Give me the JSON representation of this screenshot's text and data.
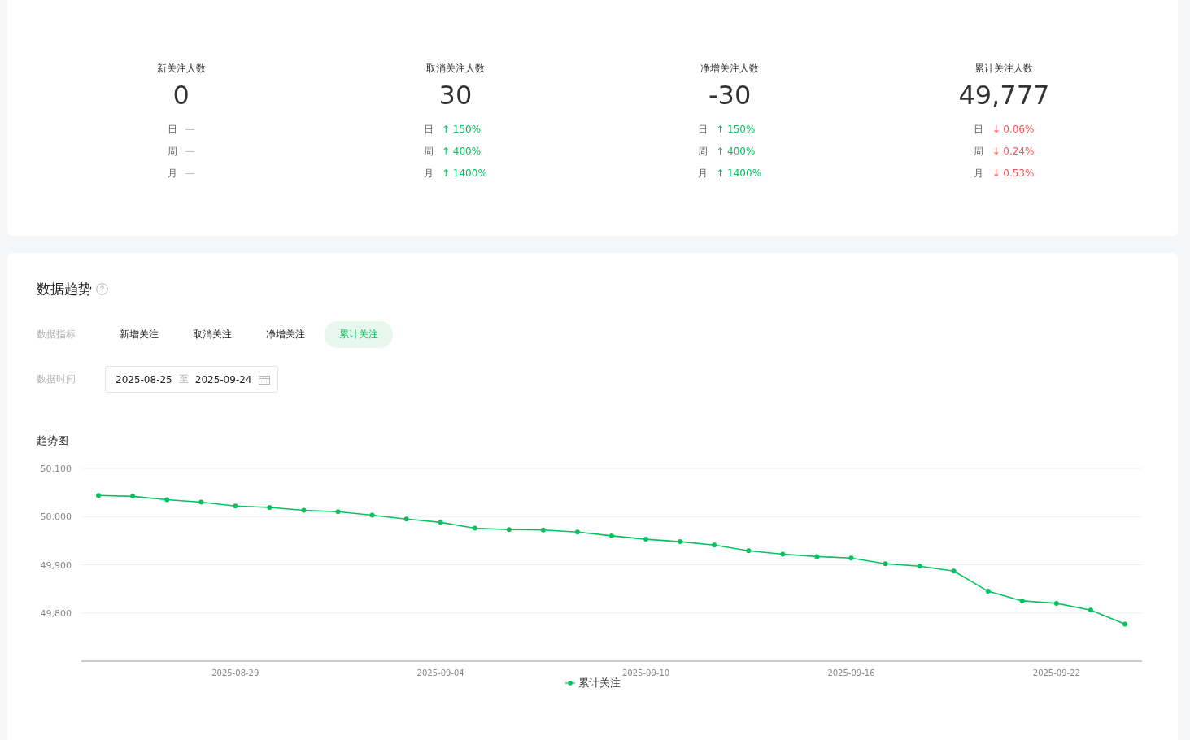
{
  "stats": [
    {
      "label": "新关注人数",
      "value": "0",
      "changes": [
        {
          "period": "日",
          "text": "—",
          "color": "#b8b8b8"
        },
        {
          "period": "周",
          "text": "—",
          "color": "#b8b8b8"
        },
        {
          "period": "月",
          "text": "—",
          "color": "#b8b8b8"
        }
      ]
    },
    {
      "label": "取消关注人数",
      "value": "30",
      "changes": [
        {
          "period": "日",
          "text": "↑ 150%",
          "color": "#07c160"
        },
        {
          "period": "周",
          "text": "↑ 400%",
          "color": "#07c160"
        },
        {
          "period": "月",
          "text": "↑ 1400%",
          "color": "#07c160"
        }
      ]
    },
    {
      "label": "净增关注人数",
      "value": "-30",
      "changes": [
        {
          "period": "日",
          "text": "↑ 150%",
          "color": "#07c160"
        },
        {
          "period": "周",
          "text": "↑ 400%",
          "color": "#07c160"
        },
        {
          "period": "月",
          "text": "↑ 1400%",
          "color": "#07c160"
        }
      ]
    },
    {
      "label": "累计关注人数",
      "value": "49,777",
      "changes": [
        {
          "period": "日",
          "text": "↓ 0.06%",
          "color": "#fa5151"
        },
        {
          "period": "周",
          "text": "↓ 0.24%",
          "color": "#fa5151"
        },
        {
          "period": "月",
          "text": "↓ 0.53%",
          "color": "#fa5151"
        }
      ]
    }
  ],
  "trend": {
    "title": "数据趋势",
    "metric_label": "数据指标",
    "metrics": [
      {
        "label": "新增关注",
        "selected": false
      },
      {
        "label": "取消关注",
        "selected": false
      },
      {
        "label": "净增关注",
        "selected": false
      },
      {
        "label": "累计关注",
        "selected": true
      }
    ],
    "time_label": "数据时间",
    "date_start": "2025-08-25",
    "date_separator": "至",
    "date_end": "2025-09-24",
    "chart_title": "趋势图",
    "chart_data": {
      "type": "line",
      "grid": true,
      "categories": [
        null,
        null,
        null,
        null,
        "2025-08-29",
        null,
        null,
        null,
        null,
        null,
        "2025-09-04",
        null,
        null,
        null,
        null,
        null,
        "2025-09-10",
        null,
        null,
        null,
        null,
        null,
        "2025-09-16",
        null,
        null,
        null,
        null,
        null,
        "2025-09-22",
        null,
        null
      ],
      "series": [
        {
          "name": "累计关注",
          "color": "#07c160",
          "marker": "circle",
          "values": [
            50044,
            50042,
            50035,
            50030,
            50022,
            50019,
            50013,
            50010,
            50003,
            49995,
            49988,
            49976,
            49973,
            49972,
            49968,
            49960,
            49953,
            49948,
            49941,
            49929,
            49922,
            49917,
            49914,
            49902,
            49897,
            49887,
            49845,
            49825,
            49820,
            49806,
            49777
          ]
        }
      ],
      "ylim": [
        49700,
        50100
      ],
      "yticks": [
        {
          "value": 49800,
          "label": "49,800"
        },
        {
          "value": 49900,
          "label": "49,900"
        },
        {
          "value": 50000,
          "label": "50,000"
        },
        {
          "value": 50100,
          "label": "50,100"
        }
      ]
    }
  }
}
